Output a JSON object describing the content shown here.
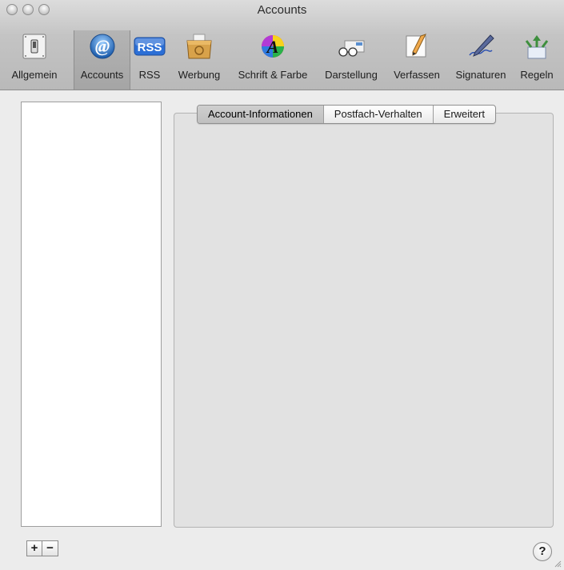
{
  "window": {
    "title": "Accounts"
  },
  "toolbar": {
    "items": [
      {
        "label": "Allgemein",
        "icon": "switch-icon",
        "selected": false
      },
      {
        "label": "Accounts",
        "icon": "at-sign-icon",
        "selected": true
      },
      {
        "label": "RSS",
        "icon": "rss-icon",
        "selected": false
      },
      {
        "label": "Werbung",
        "icon": "junk-mail-bin-icon",
        "selected": false
      },
      {
        "label": "Schrift & Farbe",
        "icon": "font-color-icon",
        "selected": false
      },
      {
        "label": "Darstellung",
        "icon": "glasses-icon",
        "selected": false
      },
      {
        "label": "Verfassen",
        "icon": "compose-pencil-icon",
        "selected": false
      },
      {
        "label": "Signaturen",
        "icon": "signature-pen-icon",
        "selected": false
      },
      {
        "label": "Regeln",
        "icon": "rules-arrows-icon",
        "selected": false
      }
    ]
  },
  "tabs": {
    "items": [
      {
        "label": "Account-Informationen",
        "active": true
      },
      {
        "label": "Postfach-Verhalten",
        "active": false
      },
      {
        "label": "Erweitert",
        "active": false
      }
    ]
  },
  "footer": {
    "add_label": "+",
    "remove_label": "−",
    "help_label": "?"
  },
  "colors": {
    "toolbar_selected": "#a9a9a9",
    "panel_background": "#e2e2e2",
    "rss_blue": "#2c6fd6"
  }
}
